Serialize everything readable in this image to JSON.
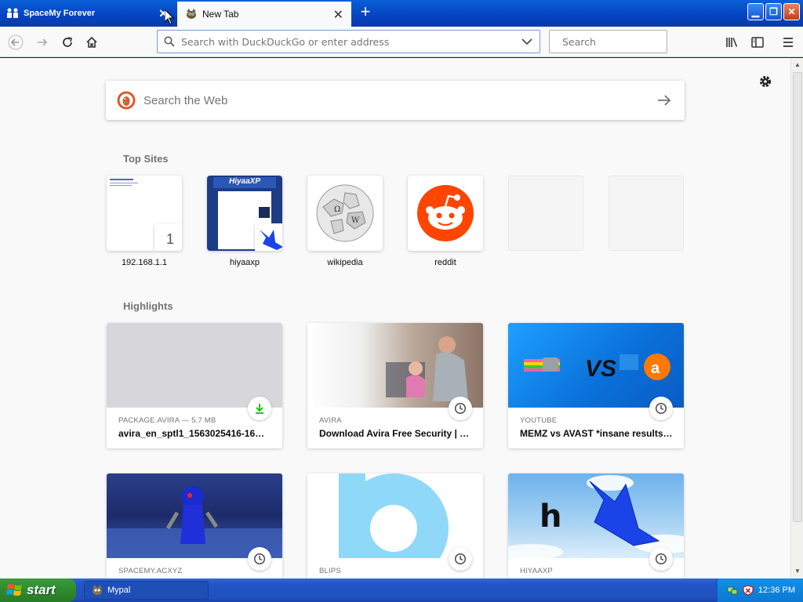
{
  "window": {
    "tabs": [
      {
        "label": "SpaceMy Forever",
        "active": false
      },
      {
        "label": "New Tab",
        "active": true
      }
    ],
    "newtab_symbol": "+"
  },
  "navbar": {
    "url_placeholder": "Search with DuckDuckGo or enter address",
    "search_placeholder": "Search"
  },
  "newtab": {
    "websearch_placeholder": "Search the Web",
    "top_sites_title": "Top Sites",
    "top_sites": [
      {
        "label": "192.168.1.1",
        "badge": "1"
      },
      {
        "label": "hiyaaxp",
        "thumb_title": "HiyaaXP"
      },
      {
        "label": "wikipedia"
      },
      {
        "label": "reddit"
      },
      {
        "label": ""
      },
      {
        "label": ""
      }
    ],
    "highlights_title": "Highlights",
    "highlights": [
      {
        "source": "PACKAGE.AVIRA — 5.7 MB",
        "title": "avira_en_sptl1_1563025416-16…",
        "type": "download"
      },
      {
        "source": "AVIRA",
        "title": "Download Avira Free Security | …",
        "type": "history"
      },
      {
        "source": "YOUTUBE",
        "title": "MEMZ vs AVAST *insane results…",
        "type": "history",
        "thumb_text": "VS"
      },
      {
        "source": "SPACEMY.ACXYZ",
        "title": "",
        "type": "history"
      },
      {
        "source": "BLIPS",
        "title": "",
        "type": "history"
      },
      {
        "source": "HIYAAXP",
        "title": "",
        "type": "history",
        "thumb_text": "h"
      }
    ]
  },
  "taskbar": {
    "start_label": "start",
    "task_label": "Mypal",
    "clock": "12:36 PM"
  },
  "colors": {
    "reddit": "#ff4500",
    "ddg": "#de5833",
    "xp_blue": "#0a5fd8",
    "start_green": "#2f8a2f"
  }
}
